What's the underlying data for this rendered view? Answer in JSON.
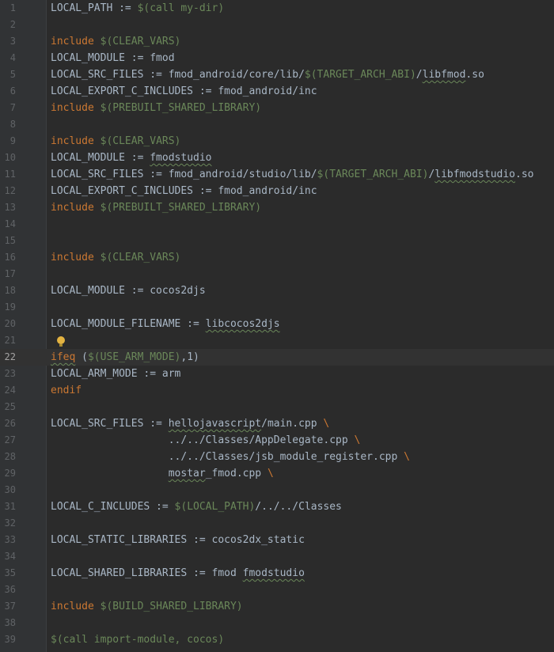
{
  "editor": {
    "current_line": 22,
    "lines": [
      {
        "n": "1",
        "segs": [
          {
            "t": "LOCAL_PATH := "
          },
          {
            "t": "$(call my-dir)",
            "c": "macro"
          }
        ]
      },
      {
        "n": "2",
        "segs": []
      },
      {
        "n": "3",
        "segs": [
          {
            "t": "include",
            "c": "kw"
          },
          {
            "t": " "
          },
          {
            "t": "$(CLEAR_VARS)",
            "c": "macro"
          }
        ]
      },
      {
        "n": "4",
        "segs": [
          {
            "t": "LOCAL_MODULE := fmod"
          }
        ]
      },
      {
        "n": "5",
        "segs": [
          {
            "t": "LOCAL_SRC_FILES := fmod_android/core/lib/"
          },
          {
            "t": "$(TARGET_ARCH_ABI)",
            "c": "macro"
          },
          {
            "t": "/"
          },
          {
            "t": "libfmod",
            "u": true
          },
          {
            "t": ".so"
          }
        ]
      },
      {
        "n": "6",
        "segs": [
          {
            "t": "LOCAL_EXPORT_C_INCLUDES := fmod_android/inc"
          }
        ]
      },
      {
        "n": "7",
        "segs": [
          {
            "t": "include",
            "c": "kw"
          },
          {
            "t": " "
          },
          {
            "t": "$(PREBUILT_SHARED_LIBRARY)",
            "c": "macro"
          }
        ]
      },
      {
        "n": "8",
        "segs": []
      },
      {
        "n": "9",
        "segs": [
          {
            "t": "include",
            "c": "kw"
          },
          {
            "t": " "
          },
          {
            "t": "$(CLEAR_VARS)",
            "c": "macro"
          }
        ]
      },
      {
        "n": "10",
        "segs": [
          {
            "t": "LOCAL_MODULE := "
          },
          {
            "t": "fmodstudio",
            "u": true
          }
        ]
      },
      {
        "n": "11",
        "segs": [
          {
            "t": "LOCAL_SRC_FILES := fmod_android/studio/lib/"
          },
          {
            "t": "$(TARGET_ARCH_ABI)",
            "c": "macro"
          },
          {
            "t": "/"
          },
          {
            "t": "libfmodstudio",
            "u": true
          },
          {
            "t": ".so"
          }
        ]
      },
      {
        "n": "12",
        "segs": [
          {
            "t": "LOCAL_EXPORT_C_INCLUDES := fmod_android/inc"
          }
        ]
      },
      {
        "n": "13",
        "segs": [
          {
            "t": "include",
            "c": "kw"
          },
          {
            "t": " "
          },
          {
            "t": "$(PREBUILT_SHARED_LIBRARY)",
            "c": "macro"
          }
        ]
      },
      {
        "n": "14",
        "segs": []
      },
      {
        "n": "15",
        "segs": []
      },
      {
        "n": "16",
        "segs": [
          {
            "t": "include",
            "c": "kw"
          },
          {
            "t": " "
          },
          {
            "t": "$(CLEAR_VARS)",
            "c": "macro"
          }
        ]
      },
      {
        "n": "17",
        "segs": []
      },
      {
        "n": "18",
        "segs": [
          {
            "t": "LOCAL_MODULE := cocos2djs"
          }
        ]
      },
      {
        "n": "19",
        "segs": []
      },
      {
        "n": "20",
        "segs": [
          {
            "t": "LOCAL_MODULE_FILENAME := "
          },
          {
            "t": "libcocos2djs",
            "u": true
          }
        ]
      },
      {
        "n": "21",
        "segs": [],
        "bulb": true
      },
      {
        "n": "22",
        "segs": [
          {
            "t": "ifeq",
            "c": "kw",
            "u": true
          },
          {
            "t": " ("
          },
          {
            "t": "$(USE_ARM_MODE)",
            "c": "macro"
          },
          {
            "t": ",1)"
          }
        ]
      },
      {
        "n": "23",
        "segs": [
          {
            "t": "LOCAL_ARM_MODE := arm"
          }
        ]
      },
      {
        "n": "24",
        "segs": [
          {
            "t": "endif",
            "c": "kw"
          }
        ]
      },
      {
        "n": "25",
        "segs": []
      },
      {
        "n": "26",
        "segs": [
          {
            "t": "LOCAL_SRC_FILES := "
          },
          {
            "t": "hellojavascript",
            "u": true
          },
          {
            "t": "/main.cpp "
          },
          {
            "t": "\\",
            "c": "kw"
          }
        ]
      },
      {
        "n": "27",
        "segs": [
          {
            "t": "                   ../../Classes/AppDelegate.cpp "
          },
          {
            "t": "\\",
            "c": "kw"
          }
        ]
      },
      {
        "n": "28",
        "segs": [
          {
            "t": "                   ../../Classes/jsb_module_register.cpp "
          },
          {
            "t": "\\",
            "c": "kw"
          }
        ]
      },
      {
        "n": "29",
        "segs": [
          {
            "t": "                   "
          },
          {
            "t": "mostar",
            "u": true
          },
          {
            "t": "_fmod.cpp "
          },
          {
            "t": "\\",
            "c": "kw"
          }
        ]
      },
      {
        "n": "30",
        "segs": []
      },
      {
        "n": "31",
        "segs": [
          {
            "t": "LOCAL_C_INCLUDES := "
          },
          {
            "t": "$(LOCAL_PATH)",
            "c": "macro"
          },
          {
            "t": "/../../Classes"
          }
        ]
      },
      {
        "n": "32",
        "segs": []
      },
      {
        "n": "33",
        "segs": [
          {
            "t": "LOCAL_STATIC_LIBRARIES := cocos2dx_static"
          }
        ]
      },
      {
        "n": "34",
        "segs": []
      },
      {
        "n": "35",
        "segs": [
          {
            "t": "LOCAL_SHARED_LIBRARIES := fmod "
          },
          {
            "t": "fmodstudio",
            "u": true
          }
        ]
      },
      {
        "n": "36",
        "segs": []
      },
      {
        "n": "37",
        "segs": [
          {
            "t": "include",
            "c": "kw"
          },
          {
            "t": " "
          },
          {
            "t": "$(BUILD_SHARED_LIBRARY)",
            "c": "macro"
          }
        ]
      },
      {
        "n": "38",
        "segs": []
      },
      {
        "n": "39",
        "segs": [
          {
            "t": "$(call import-module, cocos)",
            "c": "macro"
          }
        ]
      }
    ]
  }
}
